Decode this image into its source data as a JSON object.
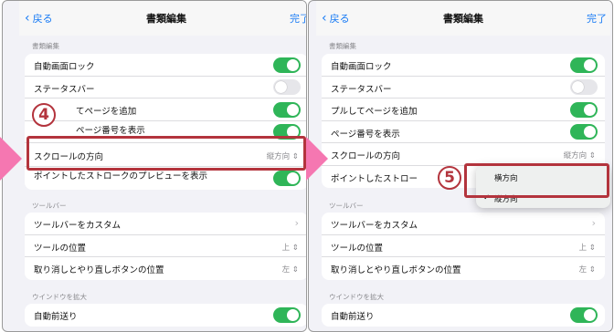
{
  "navbar": {
    "back_label": "戻る",
    "title": "書類編集",
    "done_label": "完了"
  },
  "sections": {
    "doc_edit": "書類編集",
    "toolbar": "ツールバー",
    "window_zoom": "ウインドウを拡大"
  },
  "left": {
    "rows": {
      "auto_lock": "自動画面ロック",
      "status_bar": "ステータスバー",
      "pull_add_page": "てページを追加",
      "page_number": "ページ番号を表示",
      "scroll_direction": "スクロールの方向",
      "scroll_value": "縦方向 ⇕",
      "pointed_stroke": "ポイントしたストロークのプレビューを表示"
    },
    "badge": "4"
  },
  "right": {
    "rows": {
      "auto_lock": "自動画面ロック",
      "status_bar": "ステータスバー",
      "pull_add_page": "プルしてページを追加",
      "page_number": "ページ番号を表示",
      "scroll_direction": "スクロールの方向",
      "scroll_value": "縦方向 ⇕",
      "pointed_stroke": "ポイントしたストロー"
    },
    "badge": "5",
    "popup": {
      "option_horizontal": "横方向",
      "option_vertical": "縦方向",
      "checkmark": "✓"
    }
  },
  "toolbar_rows": {
    "customize": "ツールバーをカスタム",
    "position": "ツールの位置",
    "position_value": "上 ⇕",
    "undo_redo": "取り消しとやり直しボタンの位置",
    "undo_redo_value": "左 ⇕"
  },
  "zoom_rows": {
    "auto_advance": "自動前送り"
  },
  "toggles": {
    "auto_lock": true,
    "status_bar": false,
    "pull_add_page": true,
    "page_number": true,
    "pointed_stroke": true,
    "auto_advance": true
  },
  "colors": {
    "accent": "#1a7cf5",
    "toggle_on": "#2fb558",
    "highlight": "#b3343d",
    "arrow": "#f577b1"
  }
}
